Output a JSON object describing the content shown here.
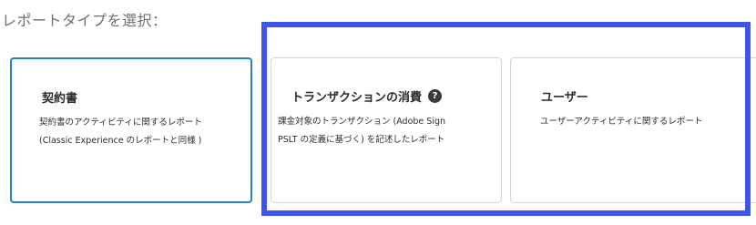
{
  "heading": "レポートタイプを選択：",
  "cards": {
    "agreements": {
      "title": "契約書",
      "desc_line1": "契約書のアクティビティに関するレポート",
      "desc_line2": "(Classic Experience のレポートと同様 )"
    },
    "transactions": {
      "title": "トランザクションの消費",
      "help_icon": "?",
      "desc_line1": "課金対象のトランザクション (Adobe Sign",
      "desc_line2": "PSLT の定義に基づく) を記述したレポート"
    },
    "users": {
      "title": "ユーザー",
      "desc_line1": "ユーザーアクティビティに関するレポート"
    }
  },
  "colors": {
    "selected_border": "#2680c2",
    "highlight": "#3e55ea",
    "card_border": "#d4d4d4"
  }
}
